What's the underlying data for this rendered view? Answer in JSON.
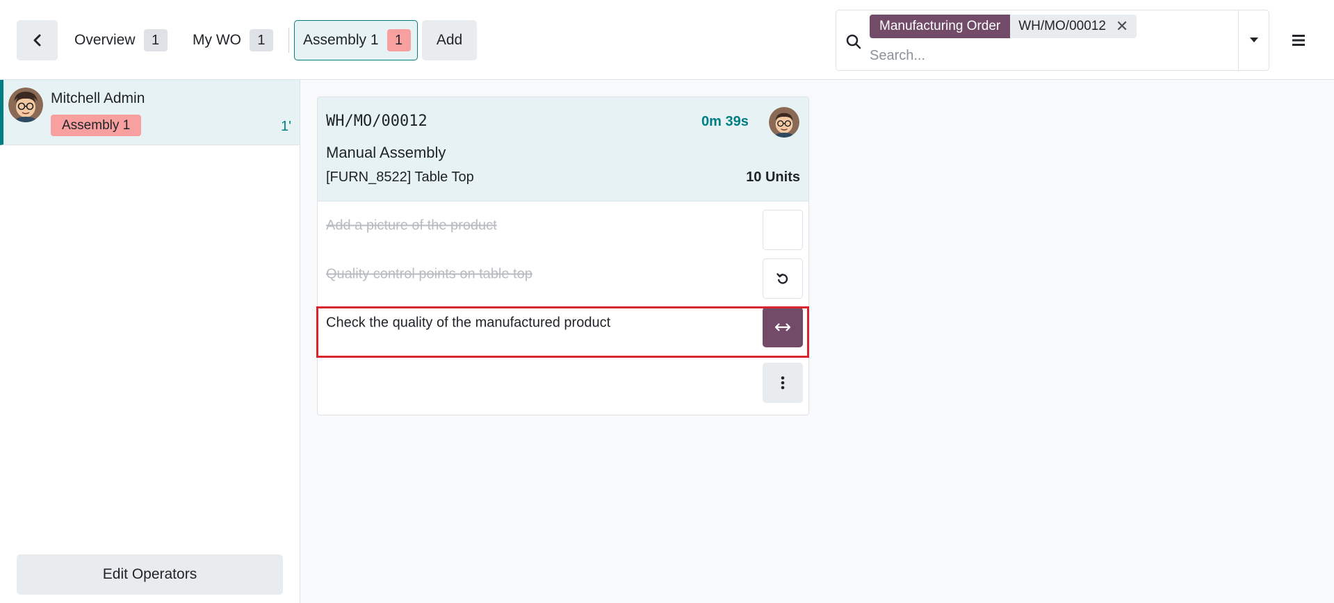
{
  "topbar": {
    "tabs": [
      {
        "label": "Overview",
        "count": "1"
      },
      {
        "label": "My WO",
        "count": "1"
      }
    ],
    "workcenter_tab": {
      "label": "Assembly 1",
      "count": "1"
    },
    "add_label": "Add"
  },
  "search": {
    "facet_label": "Manufacturing Order",
    "facet_value": "WH/MO/00012",
    "placeholder": "Search..."
  },
  "sidebar": {
    "employee_name": "Mitchell Admin",
    "employee_workcenter": "Assembly 1",
    "employee_time": "1'",
    "edit_operators_label": "Edit Operators"
  },
  "workorder": {
    "name": "WH/MO/00012",
    "timer": "0m 39s",
    "operation": "Manual Assembly",
    "product": "[FURN_8522] Table Top",
    "quantity": "10 Units",
    "steps": [
      {
        "label": "Add a picture of the product",
        "done": true
      },
      {
        "label": "Quality control points on table top",
        "done": true
      },
      {
        "label": "Check the quality of the manufactured product",
        "done": false
      }
    ]
  },
  "colors": {
    "accent": "#017e84",
    "primary": "#714b67",
    "danger_badge": "#f8a0a0",
    "highlight": "#d9232d"
  }
}
